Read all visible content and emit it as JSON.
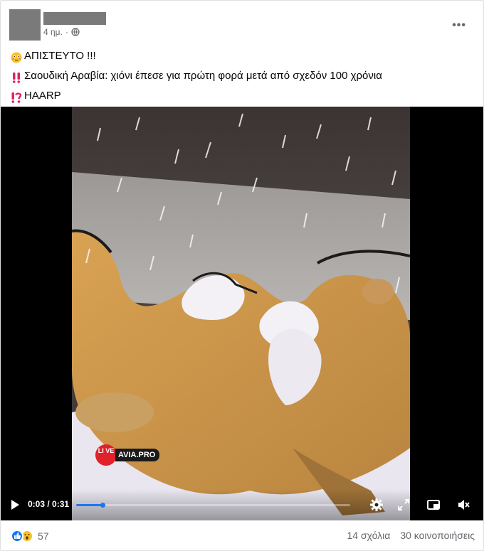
{
  "post": {
    "time": "4 ημ.",
    "separator": "·",
    "lines": [
      {
        "emoji": "flushed-face-icon",
        "text": "ΑΠΙΣΤΕΥΤΟ !!!"
      },
      {
        "emoji": "double-exclamation-icon",
        "text": "Σαουδική Αραβία: χιόνι έπεσε για πρώτη φορά μετά από σχεδόν 100 χρόνια"
      },
      {
        "emoji": "exclamation-question-icon",
        "text": "HAARP"
      }
    ]
  },
  "video": {
    "time": "0:03 / 0:31",
    "progress": 0.097,
    "watermark_live": "LI VE",
    "watermark_text": "AVIA.PRO",
    "accent": "#1877f2"
  },
  "footer": {
    "reaction_count": "57",
    "comments": "14 σχόλια",
    "shares": "30 κοινοποιήσεις"
  }
}
